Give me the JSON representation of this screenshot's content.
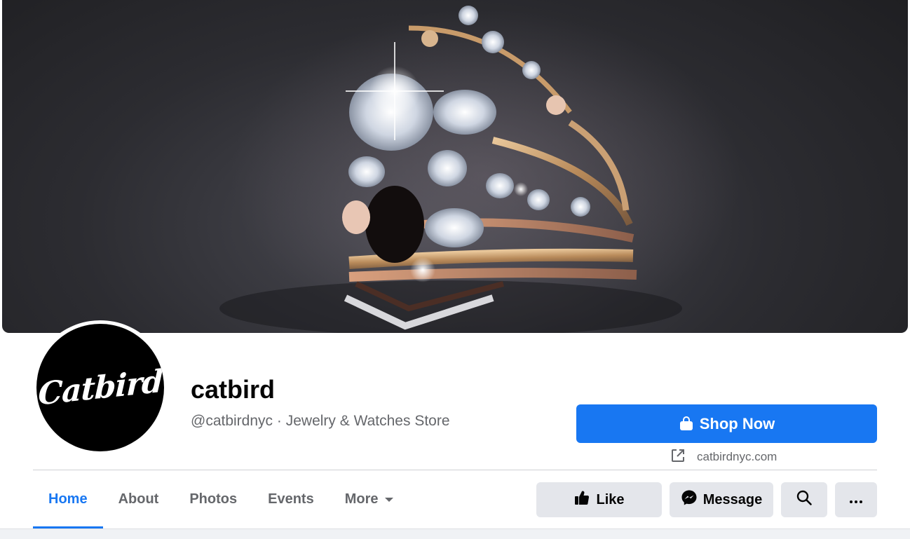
{
  "page": {
    "name": "catbird",
    "handle": "@catbirdnyc",
    "separator": "·",
    "category": "Jewelry & Watches Store",
    "avatar_text": "Catbird"
  },
  "cta": {
    "shop_label": "Shop Now",
    "website": "catbirdnyc.com"
  },
  "tabs": [
    {
      "label": "Home",
      "active": true
    },
    {
      "label": "About"
    },
    {
      "label": "Photos"
    },
    {
      "label": "Events"
    },
    {
      "label": "More"
    }
  ],
  "actions": {
    "like_label": "Like",
    "message_label": "Message"
  },
  "colors": {
    "accent": "#1877f2",
    "button_gray": "#e4e6eb",
    "secondary_text": "#65676b"
  },
  "icons": {
    "shop": "shopping-bag-icon",
    "external": "external-link-icon",
    "like": "thumbs-up-icon",
    "message": "messenger-icon",
    "search": "search-icon",
    "more": "ellipsis-icon",
    "dropdown": "caret-down-icon"
  }
}
